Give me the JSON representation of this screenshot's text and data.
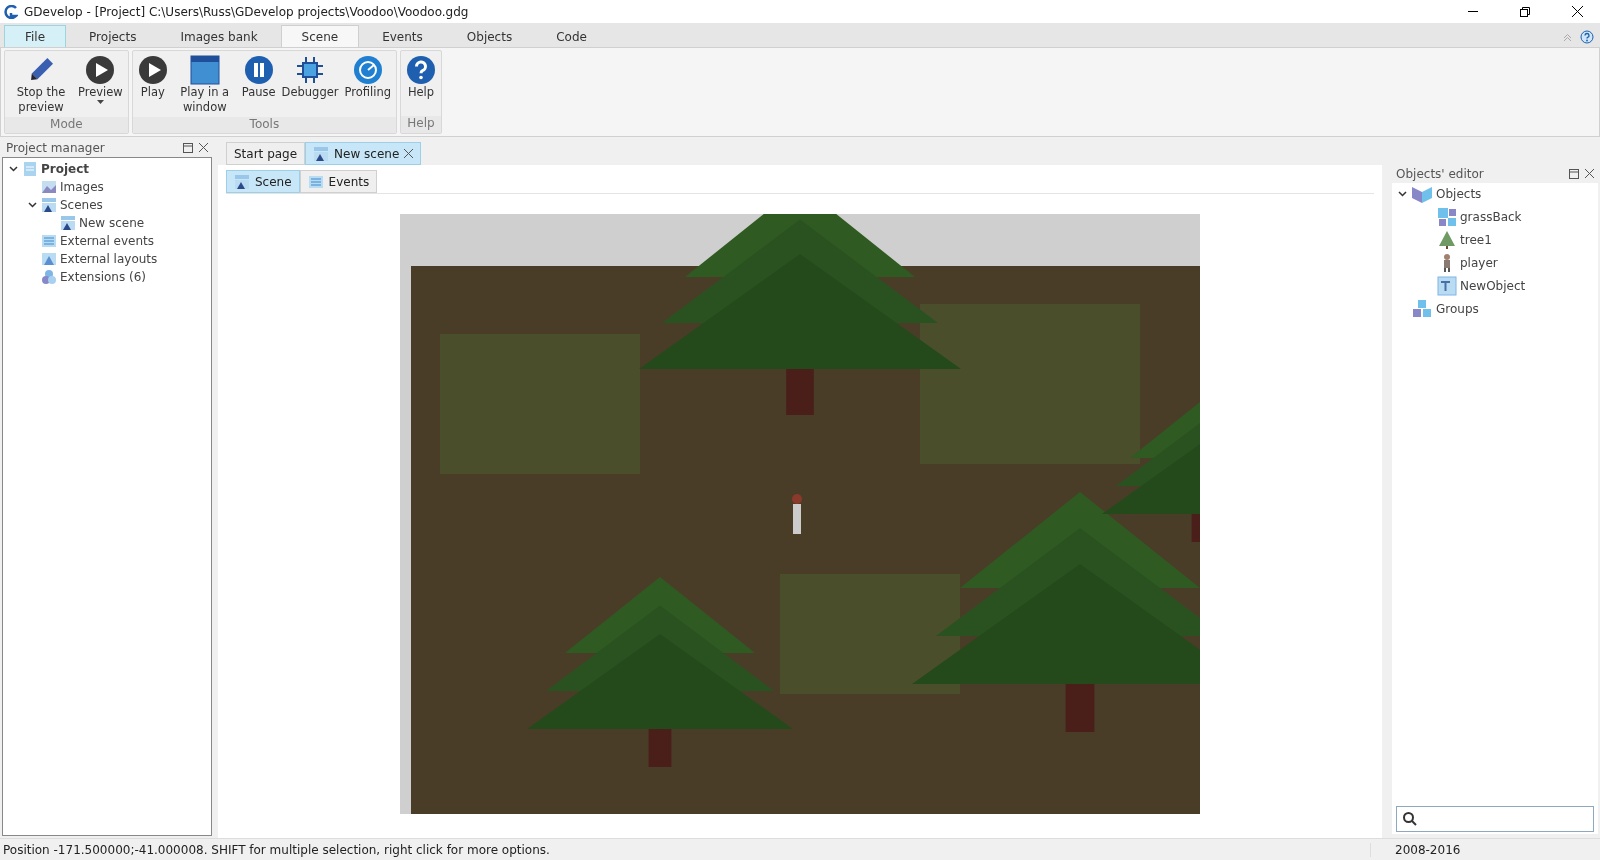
{
  "window": {
    "title": "GDevelop - [Project] C:\\Users\\Russ\\GDevelop projects\\Voodoo\\Voodoo.gdg"
  },
  "menu_tabs": [
    {
      "label": "File",
      "selected": false,
      "kind": "file"
    },
    {
      "label": "Projects",
      "selected": false,
      "kind": "tab"
    },
    {
      "label": "Images bank",
      "selected": false,
      "kind": "tab"
    },
    {
      "label": "Scene",
      "selected": true,
      "kind": "tab"
    },
    {
      "label": "Events",
      "selected": false,
      "kind": "tab"
    },
    {
      "label": "Objects",
      "selected": false,
      "kind": "tab"
    },
    {
      "label": "Code",
      "selected": false,
      "kind": "tab"
    }
  ],
  "ribbon": [
    {
      "label": "Mode",
      "buttons": [
        {
          "label": "Stop the preview",
          "kind": "pencil",
          "dropdown": false
        },
        {
          "label": "Preview",
          "kind": "play",
          "dropdown": true
        }
      ]
    },
    {
      "label": "Tools",
      "buttons": [
        {
          "label": "Play",
          "kind": "play",
          "dropdown": false
        },
        {
          "label": "Play in a window",
          "kind": "window",
          "dropdown": false
        },
        {
          "label": "Pause",
          "kind": "pause",
          "dropdown": false
        },
        {
          "label": "Debugger",
          "kind": "bug",
          "dropdown": false
        },
        {
          "label": "Profiling",
          "kind": "gauge",
          "dropdown": false
        }
      ]
    },
    {
      "label": "Help",
      "buttons": [
        {
          "label": "Help",
          "kind": "help",
          "dropdown": false
        }
      ]
    }
  ],
  "project_manager": {
    "title": "Project manager",
    "tree": [
      {
        "label": "Project",
        "kind": "project",
        "expanded": true,
        "children": [
          {
            "label": "Images",
            "kind": "images"
          },
          {
            "label": "Scenes",
            "kind": "scene",
            "expanded": true,
            "children": [
              {
                "label": "New scene",
                "kind": "scene"
              }
            ]
          },
          {
            "label": "External events",
            "kind": "events"
          },
          {
            "label": "External layouts",
            "kind": "layout"
          },
          {
            "label": "Extensions (6)",
            "kind": "extensions"
          }
        ]
      }
    ]
  },
  "document_tabs": [
    {
      "label": "Start page",
      "selected": false,
      "kind": "plain"
    },
    {
      "label": "New scene",
      "selected": true,
      "kind": "scene"
    }
  ],
  "sub_tabs": [
    {
      "label": "Scene",
      "selected": true,
      "kind": "scene"
    },
    {
      "label": "Events",
      "selected": false,
      "kind": "events"
    }
  ],
  "objects_editor": {
    "title": "Objects' editor",
    "tree": [
      {
        "label": "Objects",
        "kind": "objects",
        "expanded": true,
        "children": [
          {
            "label": "grassBack",
            "kind": "tiles"
          },
          {
            "label": "tree1",
            "kind": "tree"
          },
          {
            "label": "player",
            "kind": "player"
          },
          {
            "label": "NewObject",
            "kind": "text"
          }
        ]
      },
      {
        "label": "Groups",
        "kind": "groups"
      }
    ]
  },
  "status_bar": {
    "message": "Position -171.500000;-41.000008. SHIFT for multiple selection, right click for more options.",
    "copyright": "2008-2016"
  }
}
